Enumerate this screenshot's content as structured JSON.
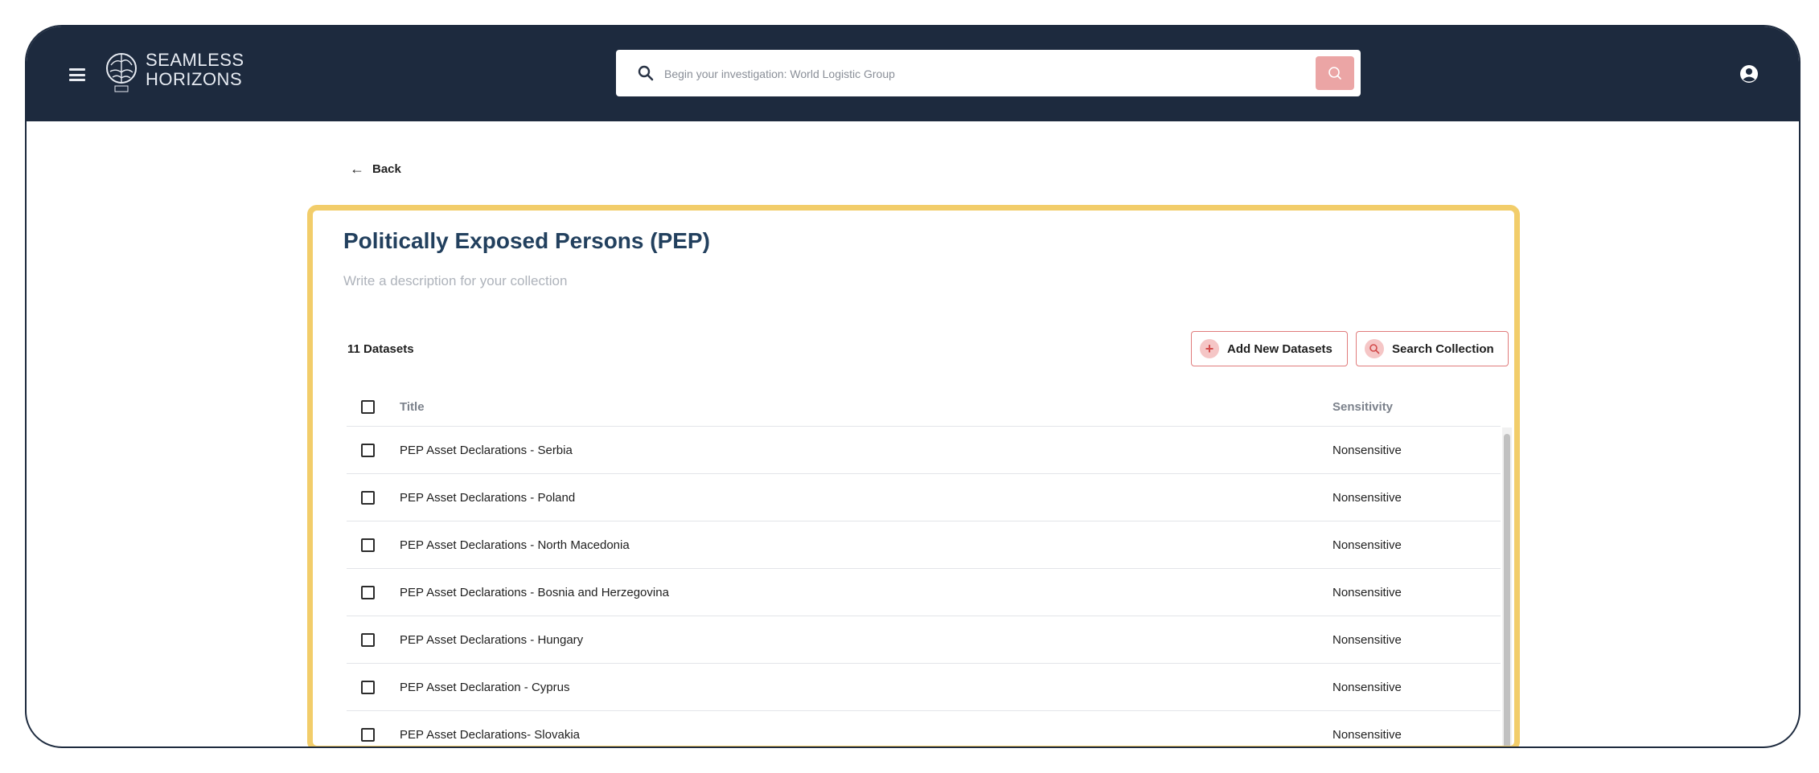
{
  "header": {
    "logo_line1": "SEAMLESS",
    "logo_line2": "HORIZONS",
    "search_placeholder": "Begin your investigation: World Logistic Group",
    "menu_icon": "hamburger-icon",
    "user_icon": "user-circle-icon"
  },
  "nav": {
    "back_label": "Back"
  },
  "collection": {
    "title": "Politically Exposed Persons (PEP)",
    "description_placeholder": "Write a description for your collection",
    "dataset_count": "11 Datasets",
    "add_button_label": "Add New Datasets",
    "search_button_label": "Search Collection"
  },
  "table": {
    "columns": [
      "Title",
      "Sensitivity"
    ],
    "rows": [
      {
        "title": "PEP Asset Declarations - Serbia",
        "sensitivity": "Nonsensitive"
      },
      {
        "title": "PEP Asset Declarations - Poland",
        "sensitivity": "Nonsensitive"
      },
      {
        "title": "PEP Asset Declarations - North Macedonia",
        "sensitivity": "Nonsensitive"
      },
      {
        "title": "PEP Asset Declarations - Bosnia and Herzegovina",
        "sensitivity": "Nonsensitive"
      },
      {
        "title": "PEP Asset Declarations - Hungary",
        "sensitivity": "Nonsensitive"
      },
      {
        "title": "PEP Asset Declaration - Cyprus",
        "sensitivity": "Nonsensitive"
      },
      {
        "title": "PEP Asset Declarations- Slovakia",
        "sensitivity": "Nonsensitive"
      }
    ]
  },
  "colors": {
    "header_bg": "#1d2a3e",
    "highlight_border": "#f2cd6a",
    "accent": "#e07b7b",
    "title_color": "#22405e"
  }
}
